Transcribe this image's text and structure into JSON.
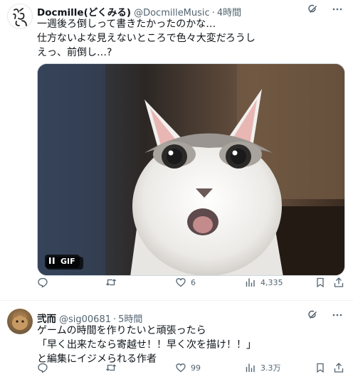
{
  "tweets": [
    {
      "name": "Docmille(どくみる)",
      "handle": "@DocmilleMusic",
      "time": "4時間",
      "lines": [
        "一週後ろ倒しって書きたかったのかな…",
        "仕方ないよな見えないところで色々大変だろうし",
        "えっ、前倒し…?"
      ],
      "media_badge": "GIF",
      "replies": "",
      "retweets": "",
      "likes": "6",
      "views": "4,335",
      "avatar_text": "どくみる"
    },
    {
      "name": "弐而",
      "handle": "@sig00681",
      "time": "5時間",
      "lines": [
        "ゲームの時間を作りたいと頑張ったら",
        "「早く出来たなら寄越せ！！早く次を描け！！」",
        "と編集にイジメられる作者"
      ],
      "replies": "",
      "retweets": "",
      "likes": "99",
      "views": "3.3万"
    }
  ],
  "separator": "·",
  "icons": {
    "grok": "grok-icon",
    "more": "more-icon",
    "reply": "reply-icon",
    "retweet": "retweet-icon",
    "like": "like-icon",
    "views": "views-icon",
    "bookmark": "bookmark-icon",
    "share": "share-icon",
    "pause": "pause-icon"
  },
  "colors": {
    "text": "#0f1419",
    "muted": "#536471",
    "border": "#eff3f4"
  }
}
